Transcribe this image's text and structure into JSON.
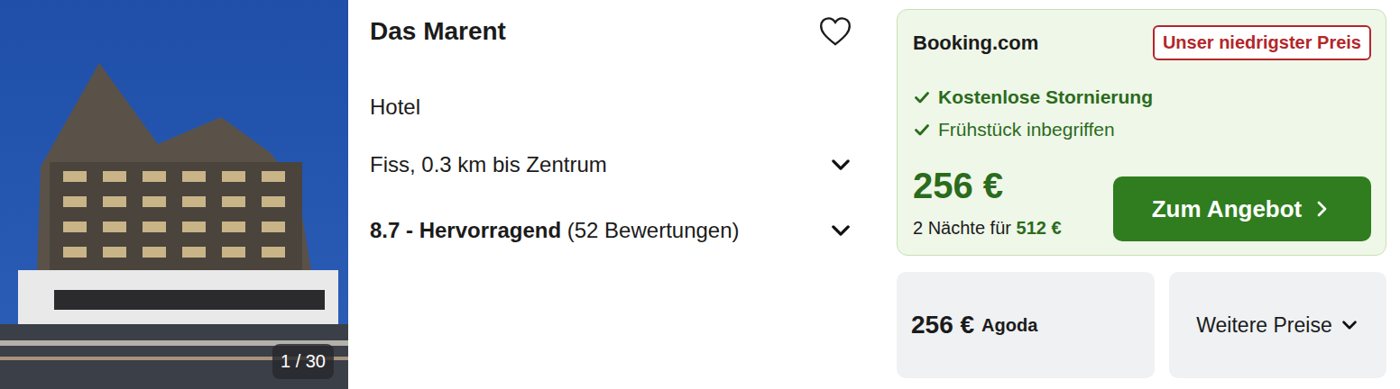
{
  "photo": {
    "counter": "1 / 30"
  },
  "hotel": {
    "name": "Das Marent",
    "type": "Hotel",
    "favorited": false
  },
  "details": [
    {
      "kind": "location",
      "text": "Fiss, 0.3 km bis Zentrum",
      "expanded": false
    },
    {
      "kind": "rating",
      "score": "8.7 - Hervorragend",
      "text": "(52 Bewertungen)",
      "expanded": false
    }
  ],
  "best_offer": {
    "provider": "Booking.com",
    "badge": "Unser niedrigster Preis",
    "features": [
      {
        "label": "Kostenlose Stornierung",
        "emphasized": true
      },
      {
        "label": "Frühstück inbegriffen",
        "emphasized": false
      }
    ],
    "price": "256 €",
    "total_label": "2 Nächte für",
    "total": "512 €",
    "button": "Zum Angebot"
  },
  "other_offers": [
    {
      "price": "256 €",
      "provider": "Agoda"
    }
  ],
  "more_prices": {
    "label": "Weitere Preise",
    "expanded": false
  }
}
